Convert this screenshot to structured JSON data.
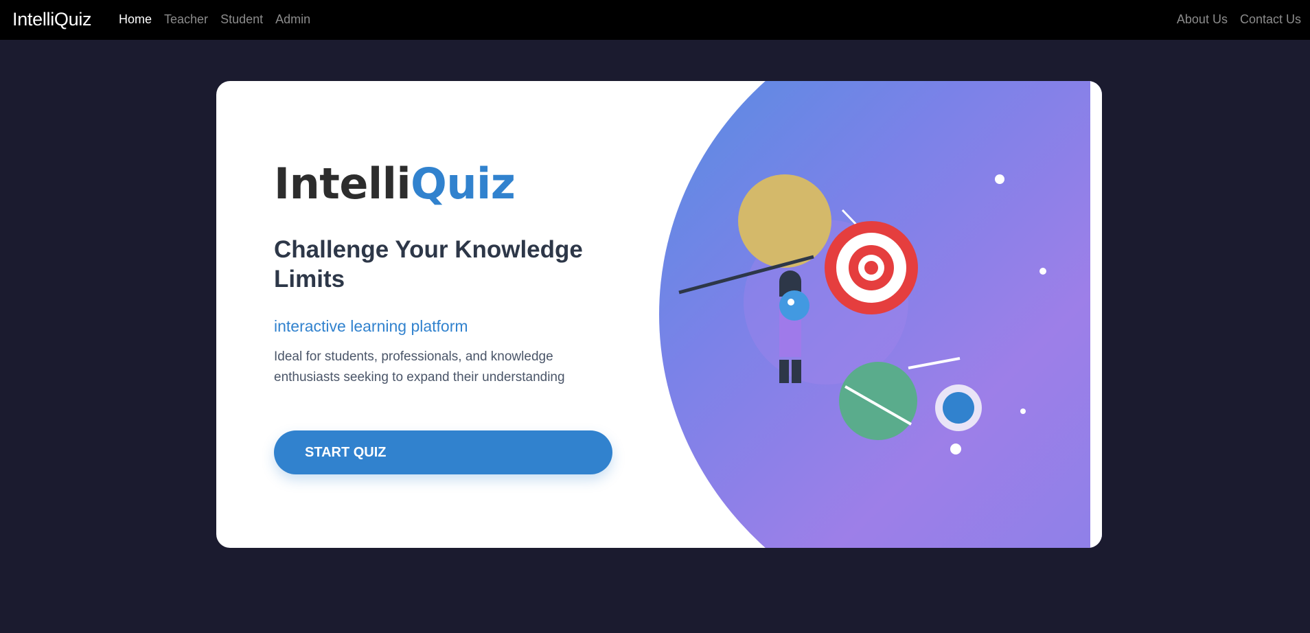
{
  "navbar": {
    "brand": "IntelliQuiz",
    "left_links": [
      {
        "label": "Home",
        "active": true
      },
      {
        "label": "Teacher",
        "active": false
      },
      {
        "label": "Student",
        "active": false
      },
      {
        "label": "Admin",
        "active": false
      }
    ],
    "right_links": [
      {
        "label": "About Us"
      },
      {
        "label": "Contact Us"
      }
    ]
  },
  "hero": {
    "title_part1": "Intelli",
    "title_part2": "Quiz",
    "headline": "Challenge Your Knowledge Limits",
    "subtitle": "interactive learning platform",
    "description": "Ideal for students, professionals, and knowledge enthusiasts seeking to expand their understanding",
    "cta_label": "START QUIZ"
  },
  "colors": {
    "page_bg": "#1b1b2f",
    "navbar_bg": "#000000",
    "accent": "#3182ce",
    "gradient_start": "#4f8fe0",
    "gradient_mid": "#9d7fe8",
    "target_red": "#e53e3e",
    "planet_yellow": "#d4b96a",
    "planet_green": "#5aac8c"
  },
  "illustration": {
    "icons": [
      "sun-icon",
      "target-icon",
      "person-icon",
      "planet-icon",
      "ring-icon",
      "star-icon"
    ]
  }
}
